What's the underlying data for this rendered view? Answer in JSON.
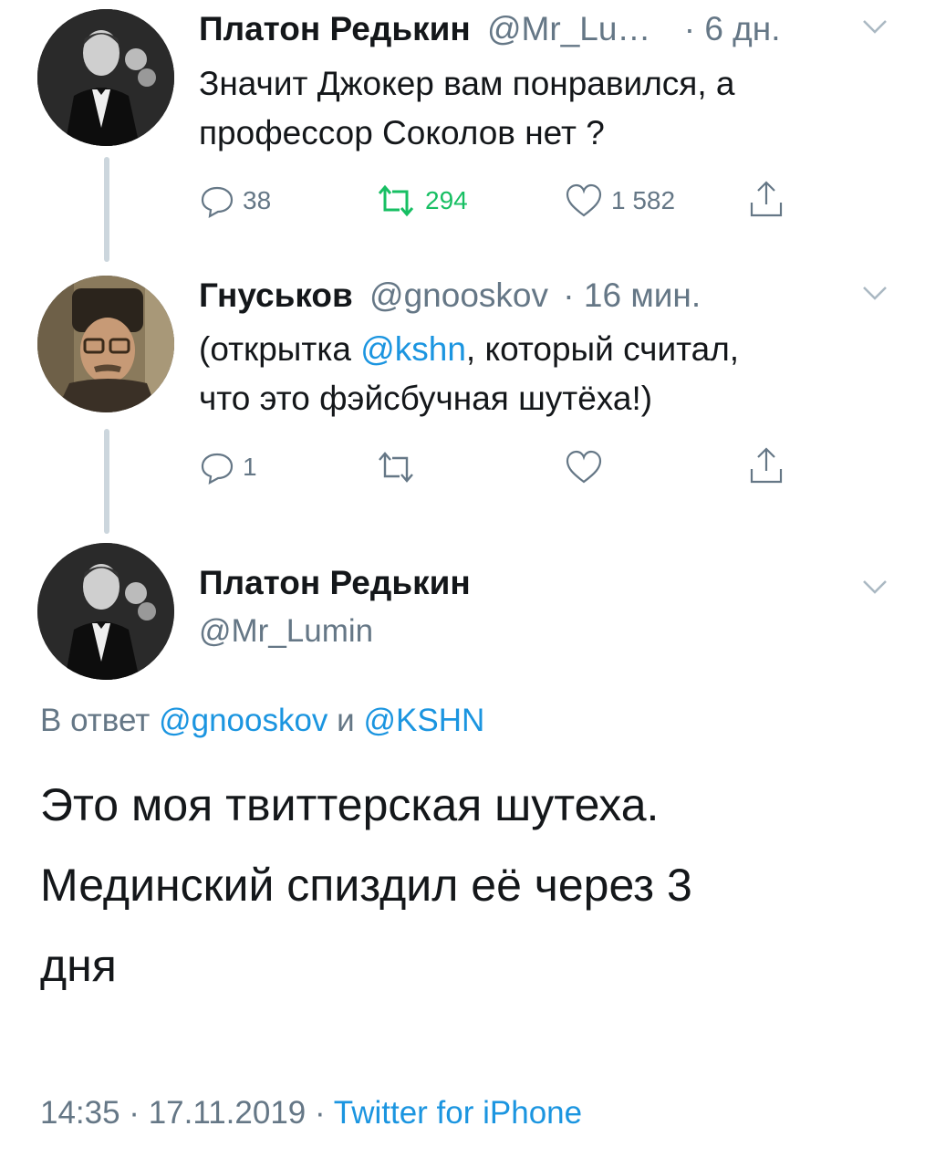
{
  "tweet1": {
    "name": "Платон Редькин",
    "handle": "@Mr_Lu…",
    "time": "· 6 дн.",
    "text_lines": [
      "Значит Джокер вам понравился, а",
      "профессор Соколов нет ?"
    ],
    "replies": "38",
    "retweets": "294",
    "likes": "1 582"
  },
  "tweet2": {
    "name": "Гнуськов",
    "handle": "@gnooskov",
    "time": "· 16 мин.",
    "text_pre": "(открытка ",
    "mention": "@kshn",
    "text_post": ", который считал,",
    "text_line2": "что это фэйсбучная шутёха!)",
    "replies": "1"
  },
  "main_tweet": {
    "name": "Платон Редькин",
    "handle": "@Mr_Lumin",
    "reply_prefix": "В ответ",
    "reply_mention1": "@gnooskov",
    "reply_and": "и",
    "reply_mention2": "@KSHN",
    "text_lines": [
      "Это моя твиттерская шутеха.",
      "Мединский спиздил её через 3",
      "дня"
    ],
    "timestamp": "14:35 · 17.11.2019 ·",
    "source": "Twitter for iPhone"
  },
  "colors": {
    "link": "#1b95e0",
    "retweet_active": "#17bf63",
    "muted": "#657786"
  },
  "icons": [
    "reply-icon",
    "retweet-icon",
    "like-icon",
    "share-icon",
    "chevron-down-icon"
  ]
}
